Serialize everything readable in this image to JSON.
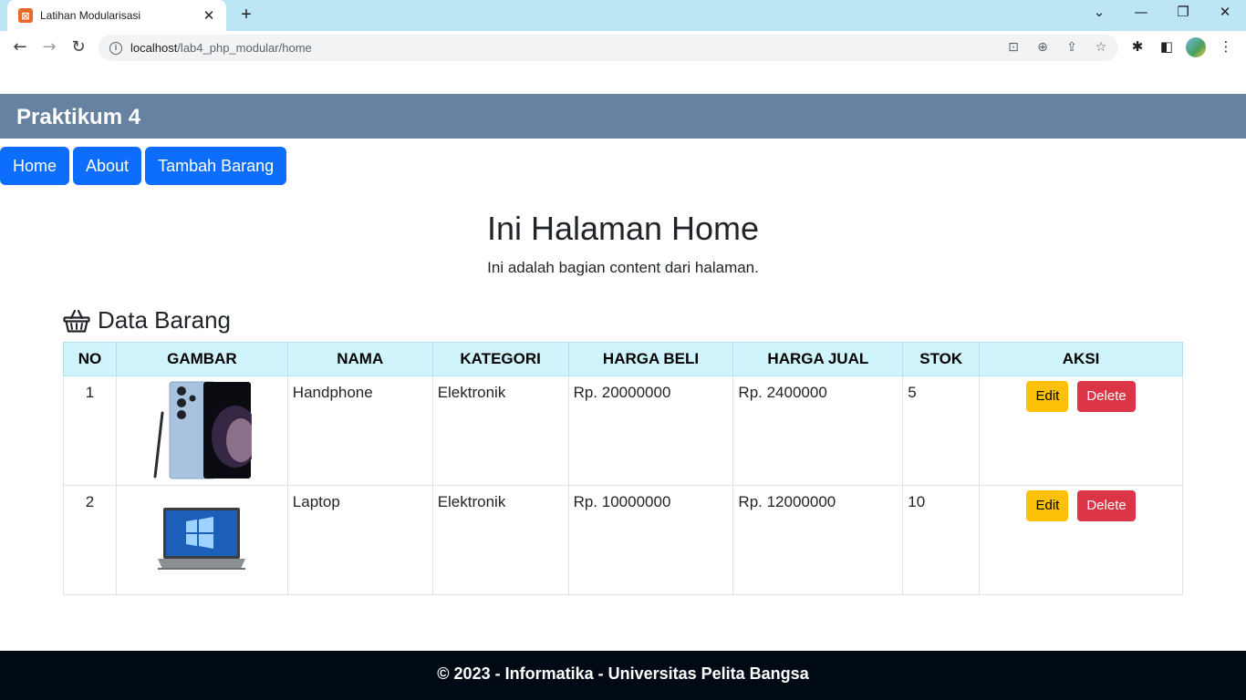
{
  "browser": {
    "tab_title": "Latihan Modularisasi",
    "tab_favicon": "xampp-icon",
    "url_host": "localhost",
    "url_path": "/lab4_php_modular/home"
  },
  "site": {
    "title": "Praktikum 4",
    "nav": [
      {
        "label": "Home"
      },
      {
        "label": "About"
      },
      {
        "label": "Tambah Barang"
      }
    ]
  },
  "content": {
    "heading": "Ini Halaman Home",
    "subheading": "Ini adalah bagian content dari halaman.",
    "section_title": "Data Barang",
    "section_icon": "basket-icon"
  },
  "table": {
    "headers": [
      "NO",
      "GAMBAR",
      "NAMA",
      "KATEGORI",
      "HARGA BELI",
      "HARGA JUAL",
      "STOK",
      "AKSI"
    ],
    "rows": [
      {
        "no": "1",
        "gambar": "phone-image",
        "nama": "Handphone",
        "kategori": "Elektronik",
        "harga_beli": "Rp. 20000000",
        "harga_jual": "Rp. 2400000",
        "stok": "5",
        "edit": "Edit",
        "delete": "Delete"
      },
      {
        "no": "2",
        "gambar": "laptop-image",
        "nama": "Laptop",
        "kategori": "Elektronik",
        "harga_beli": "Rp. 10000000",
        "harga_jual": "Rp. 12000000",
        "stok": "10",
        "edit": "Edit",
        "delete": "Delete"
      }
    ]
  },
  "footer": {
    "text": "© 2023 - Informatika - Universitas Pelita Bangsa"
  },
  "colors": {
    "header_bg": "#6781a0",
    "nav_bg": "#0d6efd",
    "table_head_bg": "#cff4fc",
    "edit_bg": "#ffc107",
    "delete_bg": "#dc3545",
    "footer_bg": "#000a14"
  }
}
